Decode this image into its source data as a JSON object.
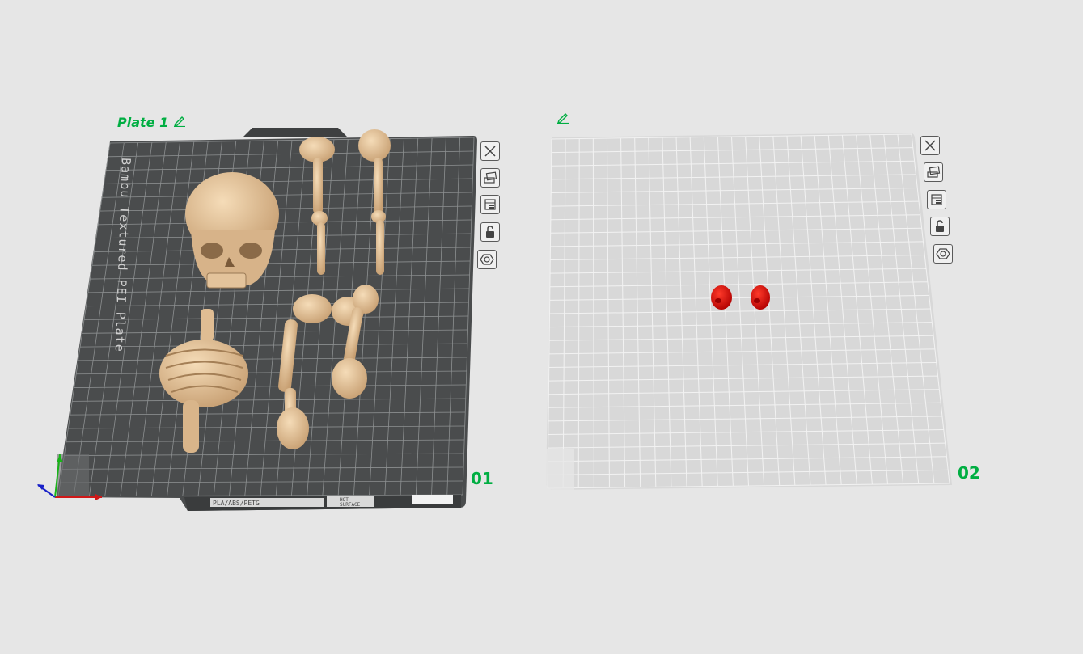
{
  "plates": [
    {
      "title": "Plate 1",
      "number": "01",
      "bed_label": "Bambu Textured PEI Plate",
      "filament_label": "PLA/ABS/PETG",
      "surface_label_1": "HOT",
      "surface_label_2": "SURFACE",
      "objects": [
        "skull",
        "leg-bone",
        "arm-bone",
        "ribcage",
        "pelvis-leg",
        "foot"
      ]
    },
    {
      "title": "",
      "number": "02",
      "objects": [
        "red-skull",
        "red-skull"
      ]
    }
  ],
  "toolbar_icons": [
    "close-icon",
    "arrange-icon",
    "layout-icon",
    "lock-icon",
    "settings-icon"
  ],
  "colors": {
    "accent": "#00ae42",
    "bed_dark": "#4a4c4d",
    "bed_light": "#d8d8d8",
    "model_bone": "#e8c9a0",
    "model_red": "#e01010"
  }
}
